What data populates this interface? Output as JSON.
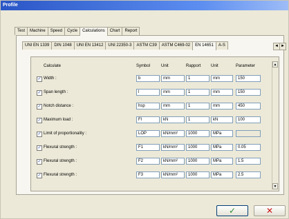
{
  "window": {
    "title": "Profile"
  },
  "top_tabs": [
    "Test",
    "Machine",
    "Speed",
    "Cycle",
    "Calculations",
    "Chart",
    "Report"
  ],
  "top_tabs_active": "Calculations",
  "sub_tabs": [
    "UNI EN 1339",
    "DIN 1048",
    "UNI EN 13412",
    "UNI 22350-3",
    "ASTM C39",
    "ASTM C469-02",
    "EN 14651",
    "A-S"
  ],
  "sub_tabs_active": "EN 14651",
  "columns": {
    "calculate": "Calculate",
    "symbol": "Symbol",
    "unit": "Unit",
    "rapport": "Rapport",
    "unit2": "Unit",
    "parameter": "Parameter"
  },
  "rows": [
    {
      "label": "Width :",
      "checked": "✓",
      "symbol": "b",
      "unit": "mm",
      "rapport": "1",
      "unit2": "mm",
      "parameter": "150"
    },
    {
      "label": "Span length :",
      "checked": "✓",
      "symbol": "l",
      "unit": "mm",
      "rapport": "1",
      "unit2": "mm",
      "parameter": "150"
    },
    {
      "label": "Notch distance :",
      "checked": "✓",
      "symbol": "hsp",
      "unit": "mm",
      "rapport": "1",
      "unit2": "mm",
      "parameter": "450"
    },
    {
      "label": "Maximum load :",
      "checked": "✓",
      "symbol": "Fl",
      "unit": "kN",
      "rapport": "1",
      "unit2": "kN",
      "parameter": "100"
    },
    {
      "label": "Limit of proportionality :",
      "checked": "✓",
      "symbol": "LOP",
      "unit": "kN/mm²",
      "rapport": "1000",
      "unit2": "MPa",
      "parameter": ""
    },
    {
      "label": "Flexural strength :",
      "checked": "✓",
      "symbol": "F1",
      "unit": "kN/mm²",
      "rapport": "1000",
      "unit2": "MPa",
      "parameter": "0.05"
    },
    {
      "label": "Flexural strength :",
      "checked": "✓",
      "symbol": "F2",
      "unit": "kN/mm²",
      "rapport": "1000",
      "unit2": "MPa",
      "parameter": "1.5"
    },
    {
      "label": "Flexural strength :",
      "checked": "✓",
      "symbol": "F3",
      "unit": "kN/mm²",
      "rapport": "1000",
      "unit2": "MPa",
      "parameter": "2.5"
    }
  ],
  "buttons": {
    "ok": "✓",
    "cancel": "✕"
  },
  "icons": {
    "scroll_up": "▲",
    "scroll_down": "▼",
    "tab_left": "◄",
    "tab_right": "►"
  },
  "colors": {
    "title_bar": "#2a56c6",
    "ok_icon": "#2c8a2c",
    "cancel_icon": "#cc1111"
  }
}
